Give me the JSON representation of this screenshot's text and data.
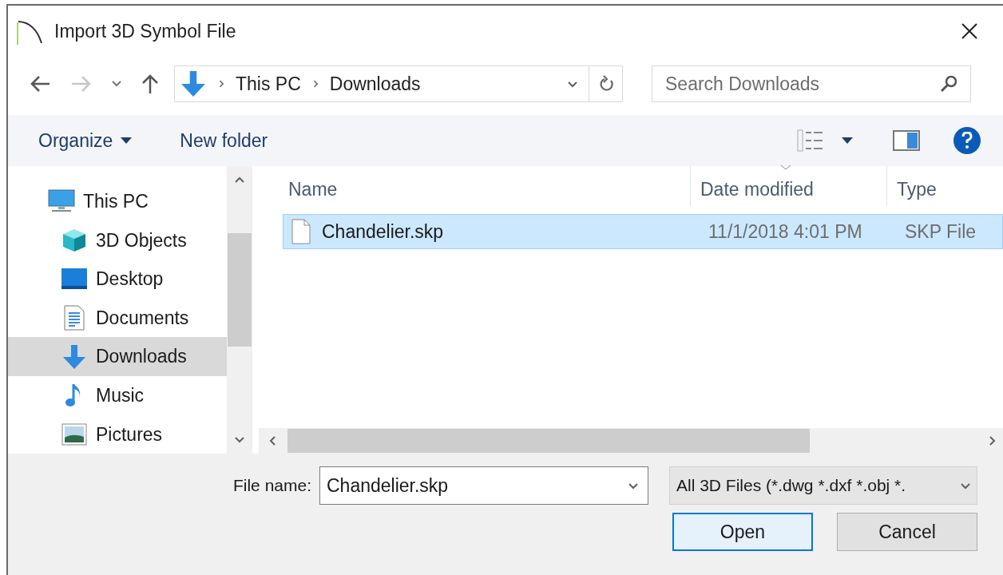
{
  "window": {
    "title": "Import 3D Symbol File"
  },
  "nav": {
    "breadcrumb": [
      "This PC",
      "Downloads"
    ],
    "search": {
      "placeholder": "Search Downloads"
    }
  },
  "toolbar": {
    "organize": "Organize",
    "new_folder": "New folder"
  },
  "sidebar": {
    "items": [
      {
        "label": "This PC",
        "kind": "pc",
        "selected": false
      },
      {
        "label": "3D Objects",
        "kind": "cube",
        "selected": false
      },
      {
        "label": "Desktop",
        "kind": "desktop",
        "selected": false
      },
      {
        "label": "Documents",
        "kind": "documents",
        "selected": false
      },
      {
        "label": "Downloads",
        "kind": "downloads",
        "selected": true
      },
      {
        "label": "Music",
        "kind": "music",
        "selected": false
      },
      {
        "label": "Pictures",
        "kind": "pictures",
        "selected": false
      }
    ]
  },
  "table": {
    "columns": [
      "Name",
      "Date modified",
      "Type"
    ],
    "rows": [
      {
        "name": "Chandelier.skp",
        "date": "11/1/2018 4:01 PM",
        "type": "SKP File",
        "selected": true
      }
    ]
  },
  "footer": {
    "file_name_label": "File name:",
    "file_name": "Chandelier.skp",
    "file_type": "All 3D Files (*.dwg *.dxf *.obj *.",
    "buttons": [
      "Open",
      "Cancel"
    ]
  }
}
